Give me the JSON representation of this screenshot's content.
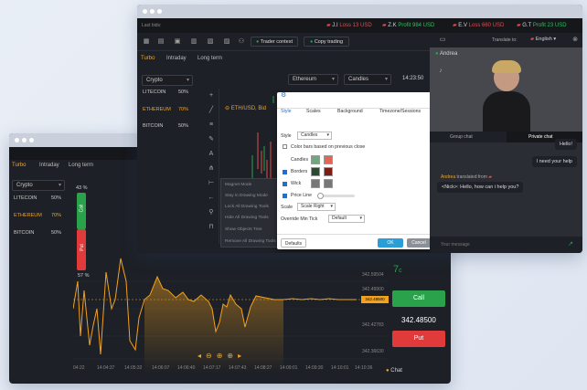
{
  "back": {
    "tabs": [
      "Turbo",
      "Intraday",
      "Long term"
    ],
    "asset_select": "Crypto",
    "assets": [
      {
        "name": "LITECOIN",
        "pct": "50%"
      },
      {
        "name": "ETHEREUM",
        "pct": "70%"
      },
      {
        "name": "BITCOIN",
        "pct": "50%"
      }
    ],
    "sentiment": {
      "call_pct": "43 %",
      "put_pct": "57 %",
      "call_label": "Call",
      "put_label": "Put"
    },
    "timer": "7",
    "timer_unit": "c",
    "price_ticks": [
      "342.59504",
      "342.49900",
      "342.48500",
      "342.42783",
      "342.36630"
    ],
    "current_price_tag": "342.48500",
    "time_ticks": [
      "04:22",
      "14:04:37",
      "14:05:32",
      "14:06:07",
      "14:06:40",
      "14:07:17",
      "14:07:43",
      "14:08:27",
      "14:09:01",
      "14:09:30",
      "14:10:01",
      "14:10:36"
    ],
    "call_button": "Call",
    "put_button": "Put",
    "price_display": "342.48500",
    "chat_label": "Chat",
    "colors": {
      "accent": "#f4a21d",
      "call": "#2aa14b",
      "put": "#e03a3a"
    }
  },
  "front": {
    "ticker_label": "Last bids:",
    "ticker": [
      {
        "name": "J.I",
        "text": "Loss 13 USD",
        "color": "#e24b4b"
      },
      {
        "name": "Z.K",
        "text": "Profit 984 USD",
        "color": "#2fbf5b"
      },
      {
        "name": "E.V",
        "text": "Loss 660 USD",
        "color": "#e24b4b"
      },
      {
        "name": "G.T",
        "text": "Profit 23 USD",
        "color": "#2fbf5b"
      }
    ],
    "trader_contest": "Trader contest",
    "copy_trading": "Copy trading",
    "tabs": [
      "Turbo",
      "Intraday",
      "Long term"
    ],
    "asset_select": "Crypto",
    "assets": [
      {
        "name": "LITECOIN",
        "pct": "50%"
      },
      {
        "name": "ETHEREUM",
        "pct": "70%"
      },
      {
        "name": "BITCOIN",
        "pct": "50%"
      }
    ],
    "symbol_select": "Ethereum",
    "chart_type_select": "Candles",
    "clock": "14:23:50",
    "pair_label": "ETH/USD, Bid",
    "translate_label": "Translate to:",
    "language": "English",
    "agent_name": "Andrea",
    "group_chat": "Group chat",
    "private_chat": "Private chat",
    "messages": [
      {
        "text": "Hello!"
      },
      {
        "text": "I need your help"
      }
    ],
    "reply_name": "Andrea",
    "reply_translated": "translated from",
    "reply_text": "<Nick>: Hello, how can i help you?",
    "input_placeholder": "Your message",
    "dialog": {
      "tabs": [
        "Style",
        "Scales",
        "Background",
        "Timezone/Sessions"
      ],
      "style_label": "Style",
      "style_value": "Candles",
      "color_bars": "Color bars based on previous close",
      "candles": "Candles",
      "borders": "Borders",
      "wick": "Wick",
      "price_line": "Price Line",
      "scale_label": "Scale",
      "scale_value": "Scale Right",
      "override_label": "Override Min Tick",
      "override_value": "Default",
      "defaults": "Defaults",
      "ok": "OK",
      "cancel": "Cancel"
    },
    "menu": [
      "Magnet Mode",
      "Stay in Drawing Mode",
      "Lock All Drawing Tools",
      "Hide All Drawing Tools",
      "Show Objects Tree",
      "Remove All Drawing Tools"
    ]
  }
}
